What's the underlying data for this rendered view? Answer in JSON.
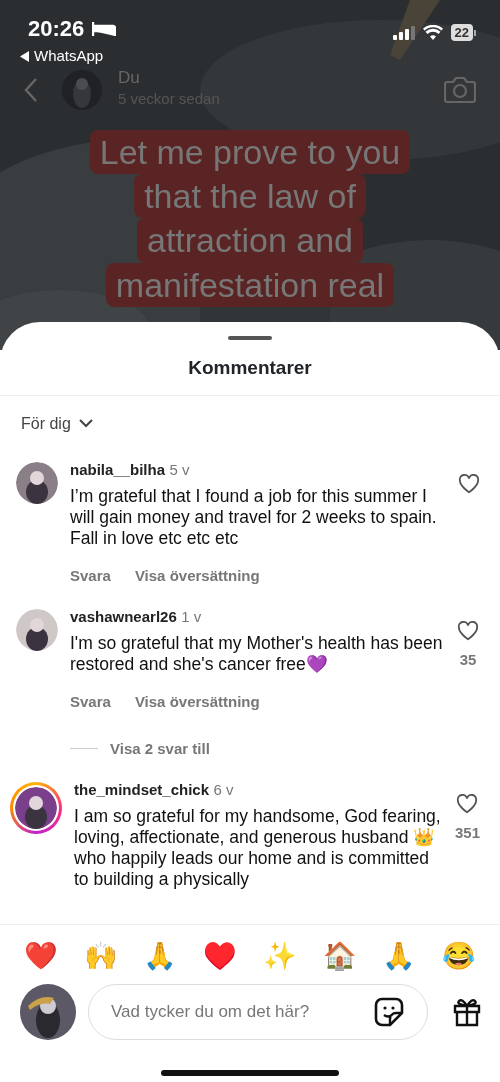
{
  "status_bar": {
    "time": "20:26",
    "back_app": "WhatsApp",
    "battery": "22"
  },
  "post": {
    "author": "Du",
    "age": "5 veckor sedan",
    "caption_lines": [
      "Let me prove to you",
      "that the law of",
      "attraction and",
      "manifestation real"
    ]
  },
  "sheet": {
    "title": "Kommentarer",
    "sort": "För dig"
  },
  "comments": [
    {
      "username": "nabila__bilha",
      "age": "5 v",
      "text": "I’m grateful that I found a job for this summer I will gain money and travel for 2 weeks to spain. Fall in love etc etc etc",
      "reply": "Svara",
      "translate": "Visa översättning",
      "liked": false,
      "story_ring": false
    },
    {
      "username": "vashawnearl26",
      "age": "1 v",
      "text": "I'm so grateful that my Mother's health has been restored and she's cancer free💜",
      "reply": "Svara",
      "translate": "Visa översättning",
      "likes": "35",
      "liked": false,
      "story_ring": false,
      "more_replies": "Visa 2 svar till"
    },
    {
      "username": "the_mindset_chick",
      "age": "6 v",
      "text": "I am so grateful for my handsome, God fearing, loving, affectionate, and generous husband 👑 who happily leads our home and is committed to building a physically",
      "likes": "351",
      "liked": false,
      "story_ring": true
    }
  ],
  "quick_reactions": [
    "❤️",
    "🙌",
    "🙏",
    "♥️",
    "✨",
    "🏠",
    "🙏",
    "😂"
  ],
  "composer": {
    "placeholder": "Vad tycker du om det här?"
  }
}
